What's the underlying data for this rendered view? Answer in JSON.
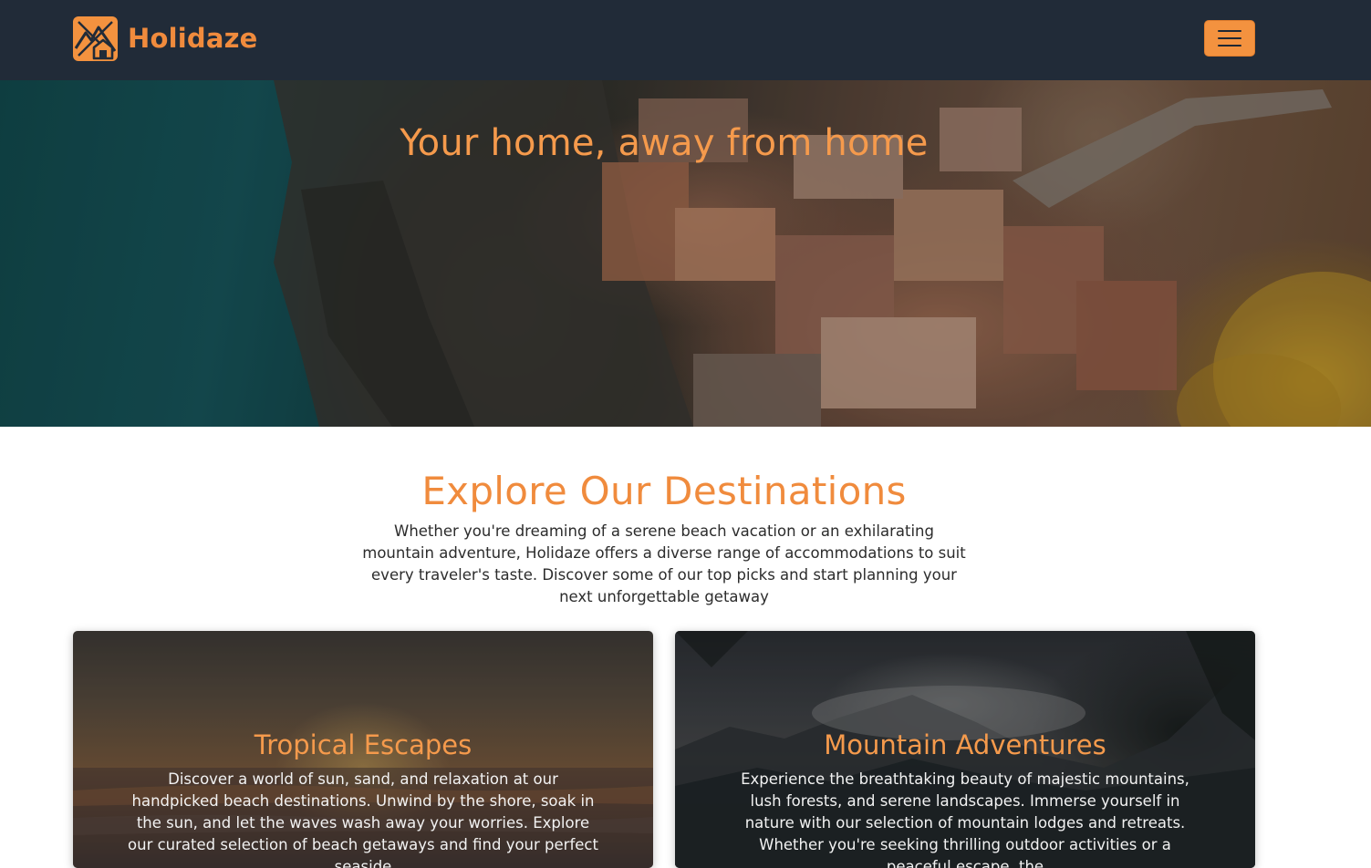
{
  "navbar": {
    "brand_name": "Holidaze",
    "logo_icon": "house-mountain-logo-icon",
    "menu_icon": "hamburger-menu-icon",
    "background_color": "#212b38",
    "accent_color": "#f08b3d"
  },
  "hero": {
    "title": "Your home, away from home",
    "image": "coastal-cliff-village-photo"
  },
  "destinations": {
    "title": "Explore Our Destinations",
    "intro": "Whether you're dreaming of a serene beach vacation or an exhilarating mountain adventure, Holidaze offers a diverse range of accommodations to suit every traveler's taste. Discover some of our top picks and start planning your next unforgettable getaway",
    "cards": [
      {
        "title": "Tropical Escapes",
        "text": "Discover a world of sun, sand, and relaxation at our handpicked beach destinations. Unwind by the shore, soak in the sun, and let the waves wash away your worries. Explore our curated selection of beach getaways and find your perfect seaside",
        "image": "beach-sunset-photo"
      },
      {
        "title": "Mountain Adventures",
        "text": "Experience the breathtaking beauty of majestic mountains, lush forests, and serene landscapes. Immerse yourself in nature with our selection of mountain lodges and retreats. Whether you're seeking thrilling outdoor activities or a peaceful escape, the",
        "image": "misty-mountains-photo"
      }
    ]
  }
}
